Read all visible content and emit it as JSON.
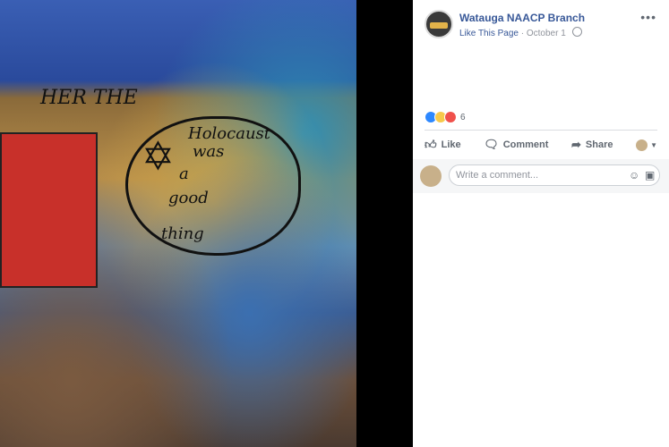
{
  "photo": {
    "graffiti": {
      "text_line1": "Holocaust",
      "text_line2": "was",
      "text_line3": "a",
      "text_line4": "good",
      "text_line5": "thing",
      "top_text": "HER THE"
    }
  },
  "post": {
    "page_name": "Watauga NAACP Branch",
    "like_page": "Like This Page",
    "separator": "·",
    "date": "October 1",
    "reaction_count": "6",
    "actions": {
      "like": "Like",
      "comment": "Comment",
      "share": "Share"
    },
    "comment_placeholder": "Write a comment...",
    "icons": {
      "more": "more-dots-icon",
      "globe": "globe-icon",
      "like": "thumb-up-icon",
      "comment": "comment-bubble-icon",
      "share": "share-arrow-icon",
      "emoji": "emoji-icon",
      "sticker": "sticker-icon"
    }
  }
}
